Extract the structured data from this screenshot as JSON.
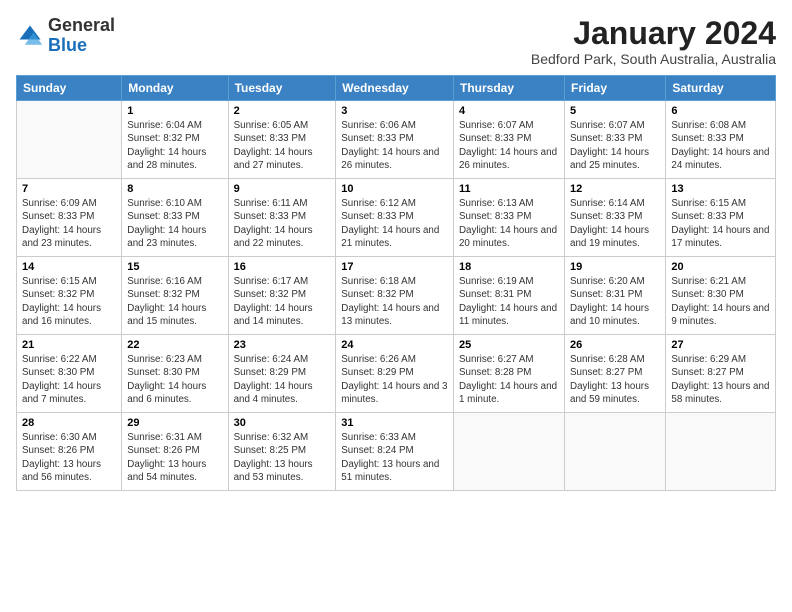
{
  "logo": {
    "general": "General",
    "blue": "Blue"
  },
  "title": "January 2024",
  "subtitle": "Bedford Park, South Australia, Australia",
  "headers": [
    "Sunday",
    "Monday",
    "Tuesday",
    "Wednesday",
    "Thursday",
    "Friday",
    "Saturday"
  ],
  "weeks": [
    [
      {
        "day": "",
        "sunrise": "",
        "sunset": "",
        "daylight": "",
        "empty": true
      },
      {
        "day": "1",
        "sunrise": "Sunrise: 6:04 AM",
        "sunset": "Sunset: 8:32 PM",
        "daylight": "Daylight: 14 hours and 28 minutes."
      },
      {
        "day": "2",
        "sunrise": "Sunrise: 6:05 AM",
        "sunset": "Sunset: 8:33 PM",
        "daylight": "Daylight: 14 hours and 27 minutes."
      },
      {
        "day": "3",
        "sunrise": "Sunrise: 6:06 AM",
        "sunset": "Sunset: 8:33 PM",
        "daylight": "Daylight: 14 hours and 26 minutes."
      },
      {
        "day": "4",
        "sunrise": "Sunrise: 6:07 AM",
        "sunset": "Sunset: 8:33 PM",
        "daylight": "Daylight: 14 hours and 26 minutes."
      },
      {
        "day": "5",
        "sunrise": "Sunrise: 6:07 AM",
        "sunset": "Sunset: 8:33 PM",
        "daylight": "Daylight: 14 hours and 25 minutes."
      },
      {
        "day": "6",
        "sunrise": "Sunrise: 6:08 AM",
        "sunset": "Sunset: 8:33 PM",
        "daylight": "Daylight: 14 hours and 24 minutes."
      }
    ],
    [
      {
        "day": "7",
        "sunrise": "Sunrise: 6:09 AM",
        "sunset": "Sunset: 8:33 PM",
        "daylight": "Daylight: 14 hours and 23 minutes."
      },
      {
        "day": "8",
        "sunrise": "Sunrise: 6:10 AM",
        "sunset": "Sunset: 8:33 PM",
        "daylight": "Daylight: 14 hours and 23 minutes."
      },
      {
        "day": "9",
        "sunrise": "Sunrise: 6:11 AM",
        "sunset": "Sunset: 8:33 PM",
        "daylight": "Daylight: 14 hours and 22 minutes."
      },
      {
        "day": "10",
        "sunrise": "Sunrise: 6:12 AM",
        "sunset": "Sunset: 8:33 PM",
        "daylight": "Daylight: 14 hours and 21 minutes."
      },
      {
        "day": "11",
        "sunrise": "Sunrise: 6:13 AM",
        "sunset": "Sunset: 8:33 PM",
        "daylight": "Daylight: 14 hours and 20 minutes."
      },
      {
        "day": "12",
        "sunrise": "Sunrise: 6:14 AM",
        "sunset": "Sunset: 8:33 PM",
        "daylight": "Daylight: 14 hours and 19 minutes."
      },
      {
        "day": "13",
        "sunrise": "Sunrise: 6:15 AM",
        "sunset": "Sunset: 8:33 PM",
        "daylight": "Daylight: 14 hours and 17 minutes."
      }
    ],
    [
      {
        "day": "14",
        "sunrise": "Sunrise: 6:15 AM",
        "sunset": "Sunset: 8:32 PM",
        "daylight": "Daylight: 14 hours and 16 minutes."
      },
      {
        "day": "15",
        "sunrise": "Sunrise: 6:16 AM",
        "sunset": "Sunset: 8:32 PM",
        "daylight": "Daylight: 14 hours and 15 minutes."
      },
      {
        "day": "16",
        "sunrise": "Sunrise: 6:17 AM",
        "sunset": "Sunset: 8:32 PM",
        "daylight": "Daylight: 14 hours and 14 minutes."
      },
      {
        "day": "17",
        "sunrise": "Sunrise: 6:18 AM",
        "sunset": "Sunset: 8:32 PM",
        "daylight": "Daylight: 14 hours and 13 minutes."
      },
      {
        "day": "18",
        "sunrise": "Sunrise: 6:19 AM",
        "sunset": "Sunset: 8:31 PM",
        "daylight": "Daylight: 14 hours and 11 minutes."
      },
      {
        "day": "19",
        "sunrise": "Sunrise: 6:20 AM",
        "sunset": "Sunset: 8:31 PM",
        "daylight": "Daylight: 14 hours and 10 minutes."
      },
      {
        "day": "20",
        "sunrise": "Sunrise: 6:21 AM",
        "sunset": "Sunset: 8:30 PM",
        "daylight": "Daylight: 14 hours and 9 minutes."
      }
    ],
    [
      {
        "day": "21",
        "sunrise": "Sunrise: 6:22 AM",
        "sunset": "Sunset: 8:30 PM",
        "daylight": "Daylight: 14 hours and 7 minutes."
      },
      {
        "day": "22",
        "sunrise": "Sunrise: 6:23 AM",
        "sunset": "Sunset: 8:30 PM",
        "daylight": "Daylight: 14 hours and 6 minutes."
      },
      {
        "day": "23",
        "sunrise": "Sunrise: 6:24 AM",
        "sunset": "Sunset: 8:29 PM",
        "daylight": "Daylight: 14 hours and 4 minutes."
      },
      {
        "day": "24",
        "sunrise": "Sunrise: 6:26 AM",
        "sunset": "Sunset: 8:29 PM",
        "daylight": "Daylight: 14 hours and 3 minutes."
      },
      {
        "day": "25",
        "sunrise": "Sunrise: 6:27 AM",
        "sunset": "Sunset: 8:28 PM",
        "daylight": "Daylight: 14 hours and 1 minute."
      },
      {
        "day": "26",
        "sunrise": "Sunrise: 6:28 AM",
        "sunset": "Sunset: 8:27 PM",
        "daylight": "Daylight: 13 hours and 59 minutes."
      },
      {
        "day": "27",
        "sunrise": "Sunrise: 6:29 AM",
        "sunset": "Sunset: 8:27 PM",
        "daylight": "Daylight: 13 hours and 58 minutes."
      }
    ],
    [
      {
        "day": "28",
        "sunrise": "Sunrise: 6:30 AM",
        "sunset": "Sunset: 8:26 PM",
        "daylight": "Daylight: 13 hours and 56 minutes."
      },
      {
        "day": "29",
        "sunrise": "Sunrise: 6:31 AM",
        "sunset": "Sunset: 8:26 PM",
        "daylight": "Daylight: 13 hours and 54 minutes."
      },
      {
        "day": "30",
        "sunrise": "Sunrise: 6:32 AM",
        "sunset": "Sunset: 8:25 PM",
        "daylight": "Daylight: 13 hours and 53 minutes."
      },
      {
        "day": "31",
        "sunrise": "Sunrise: 6:33 AM",
        "sunset": "Sunset: 8:24 PM",
        "daylight": "Daylight: 13 hours and 51 minutes."
      },
      {
        "day": "",
        "sunrise": "",
        "sunset": "",
        "daylight": "",
        "empty": true
      },
      {
        "day": "",
        "sunrise": "",
        "sunset": "",
        "daylight": "",
        "empty": true
      },
      {
        "day": "",
        "sunrise": "",
        "sunset": "",
        "daylight": "",
        "empty": true
      }
    ]
  ]
}
